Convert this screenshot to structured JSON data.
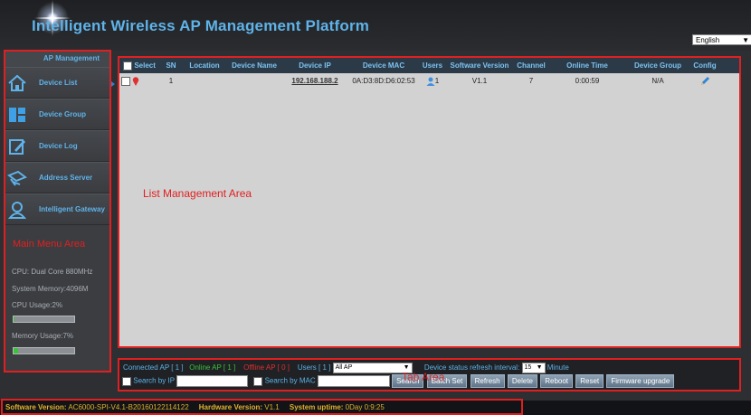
{
  "header": {
    "title": "Intelligent Wireless AP Management Platform",
    "language": "English"
  },
  "sidebar": {
    "title": "AP Management",
    "items": [
      {
        "label": "Device List",
        "icon": "home-icon"
      },
      {
        "label": "Device Group",
        "icon": "group-grid-icon"
      },
      {
        "label": "Device Log",
        "icon": "log-edit-icon"
      },
      {
        "label": "Address Server",
        "icon": "server-icon"
      },
      {
        "label": "Intelligent Gateway",
        "icon": "gateway-user-icon"
      }
    ],
    "area_label": "Main Menu Area",
    "cpu": "CPU: Dual Core 880MHz",
    "memory": "System Memory:4096M",
    "cpu_usage": "CPU Usage:2%",
    "cpu_usage_value": 0.02,
    "memory_usage": "Memory Usage:7%",
    "memory_usage_value": 0.07
  },
  "table": {
    "headers": [
      "Select",
      "SN",
      "Location",
      "Device Name",
      "Device IP",
      "Device MAC",
      "Users",
      "Software Version",
      "Channel",
      "Online Time",
      "Device Group",
      "Config"
    ],
    "rows": [
      {
        "sn": "1",
        "location": "",
        "device_name": "",
        "ip": "192.168.188.2",
        "mac": "0A:D3:8D:D6:02:53",
        "users": "1",
        "software": "V1.1",
        "channel": "7",
        "online_time": "0:00:59",
        "group": "N/A"
      }
    ],
    "area_label": "List Management Area"
  },
  "status": {
    "connected": "Connected AP [ 1 ]",
    "online": "Online AP [ 1 ]",
    "offline": "Offline AP [ 0 ]",
    "users": "Users [ 1 ]",
    "filter": "All AP",
    "refresh_label": "Device status refresh interval:",
    "refresh_value": "15",
    "refresh_unit": "Minute",
    "search_ip_label": "Search by IP",
    "search_mac_label": "Search by MAC",
    "buttons": {
      "search": "Search",
      "batch": "Batch Set",
      "refresh": "Refresh",
      "delete": "Delete",
      "reboot": "Reboot",
      "reset": "Reset",
      "firmware": "Firmware upgrade"
    },
    "area_label": "Tab Area"
  },
  "footer": {
    "software_label": "Software Version:",
    "software_value": "AC6000-SPI-V4.1-B20160122114122",
    "hardware_label": "Hardware Version:",
    "hardware_value": "V1.1",
    "uptime_label": "System uptime:",
    "uptime_value": "0Day 0:9:25"
  },
  "colors": {
    "accent_blue": "#5fb3e9",
    "annotation_red": "#e02020",
    "footer_text": "#e2b12e",
    "online_green": "#3cc13c",
    "offline_red": "#e03030"
  }
}
